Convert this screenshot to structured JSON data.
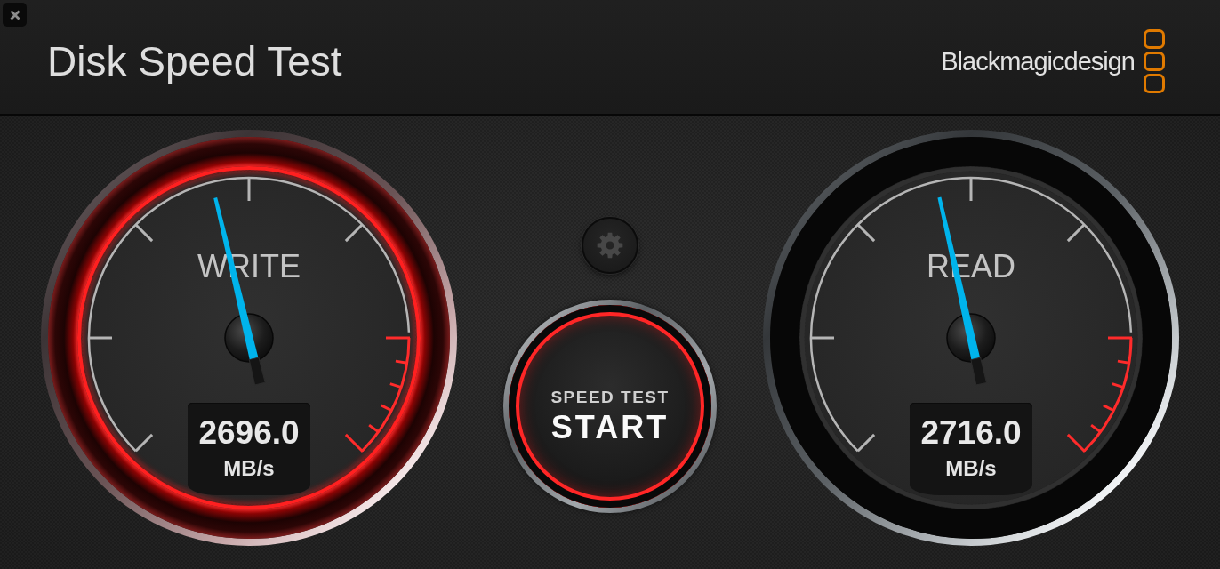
{
  "window": {
    "title": "Disk Speed Test",
    "brand": "Blackmagicdesign"
  },
  "gauges": [
    {
      "label": "WRITE",
      "value": "2696.0",
      "unit": "MB/s",
      "level": 0.45,
      "highlighted": true
    },
    {
      "label": "READ",
      "value": "2716.0",
      "unit": "MB/s",
      "level": 0.453,
      "highlighted": false
    }
  ],
  "start_button": {
    "caption": "SPEED TEST",
    "label": "START"
  }
}
